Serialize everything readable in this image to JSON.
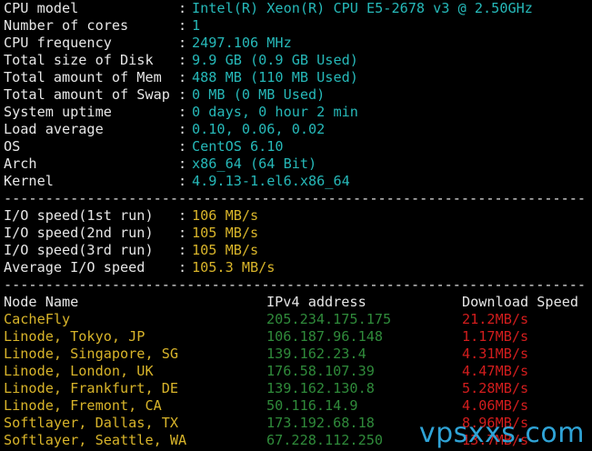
{
  "system": [
    {
      "key": "CPU model",
      "sep": ":",
      "value": "Intel(R) Xeon(R) CPU E5-2678 v3 @ 2.50GHz"
    },
    {
      "key": "Number of cores",
      "sep": ":",
      "value": "1"
    },
    {
      "key": "CPU frequency",
      "sep": ":",
      "value": "2497.106 MHz"
    },
    {
      "key": "Total size of Disk",
      "sep": ":",
      "value": "9.9 GB (0.9 GB Used)"
    },
    {
      "key": "Total amount of Mem",
      "sep": ":",
      "value": "488 MB (110 MB Used)"
    },
    {
      "key": "Total amount of Swap",
      "sep": ":",
      "value": "0 MB (0 MB Used)"
    },
    {
      "key": "System uptime",
      "sep": ":",
      "value": "0 days, 0 hour 2 min"
    },
    {
      "key": "Load average",
      "sep": ":",
      "value": "0.10, 0.06, 0.02"
    },
    {
      "key": "OS",
      "sep": ":",
      "value": "CentOS 6.10"
    },
    {
      "key": "Arch",
      "sep": ":",
      "value": "x86_64 (64 Bit)"
    },
    {
      "key": "Kernel",
      "sep": ":",
      "value": "4.9.13-1.el6.x86_64"
    }
  ],
  "separator": "----------------------------------------------------------------------",
  "io": [
    {
      "key": "I/O speed(1st run)",
      "sep": ":",
      "value": "106 MB/s"
    },
    {
      "key": "I/O speed(2nd run)",
      "sep": ":",
      "value": "105 MB/s"
    },
    {
      "key": "I/O speed(3rd run)",
      "sep": ":",
      "value": "105 MB/s"
    },
    {
      "key": "Average I/O speed",
      "sep": ":",
      "value": "105.3 MB/s"
    }
  ],
  "speedtest": {
    "headers": {
      "node": "Node Name",
      "ip": "IPv4 address",
      "speed": "Download Speed"
    },
    "rows": [
      {
        "node": "CacheFly",
        "ip": "205.234.175.175",
        "speed": "21.2MB/s"
      },
      {
        "node": "Linode, Tokyo, JP",
        "ip": "106.187.96.148",
        "speed": "1.17MB/s"
      },
      {
        "node": "Linode, Singapore, SG",
        "ip": "139.162.23.4",
        "speed": "4.31MB/s"
      },
      {
        "node": "Linode, London, UK",
        "ip": "176.58.107.39",
        "speed": "4.47MB/s"
      },
      {
        "node": "Linode, Frankfurt, DE",
        "ip": "139.162.130.8",
        "speed": "5.28MB/s"
      },
      {
        "node": "Linode, Fremont, CA",
        "ip": "50.116.14.9",
        "speed": "4.06MB/s"
      },
      {
        "node": "Softlayer, Dallas, TX",
        "ip": "173.192.68.18",
        "speed": "8.96MB/s"
      },
      {
        "node": "Softlayer, Seattle, WA",
        "ip": "67.228.112.250",
        "speed": "13.7MB/s"
      }
    ]
  },
  "watermark": "vpsxxs.com",
  "colors": {
    "value_sys": "#26b8b8",
    "value_io": "#d8b42a",
    "node": "#d8b42a",
    "ip": "#2f8a3a",
    "speed": "#d21d1d",
    "watermark": "#2fa3d6"
  }
}
